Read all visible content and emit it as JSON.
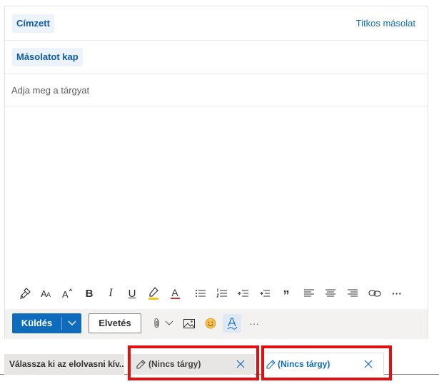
{
  "compose": {
    "to_label": "Címzett",
    "bcc_label": "Titkos másolat",
    "cc_label": "Másolatot kap",
    "subject_placeholder": "Adja meg a tárgyat"
  },
  "format_toolbar": {
    "icons": [
      "format-painter-icon",
      "font-size-icon",
      "grow-font-icon",
      "bold-icon",
      "italic-icon",
      "underline-icon",
      "highlight-icon",
      "font-color-icon",
      "bullets-icon",
      "numbering-icon",
      "decrease-indent-icon",
      "increase-indent-icon",
      "quote-icon",
      "align-left-icon",
      "align-center-icon",
      "align-right-icon",
      "link-icon",
      "more-icon"
    ],
    "bold": "B",
    "italic": "I",
    "underline": "U",
    "font_color": "A",
    "quote": "”",
    "more": "···"
  },
  "actions": {
    "send_label": "Küldés",
    "discard_label": "Elvetés",
    "more": "···"
  },
  "tabs": {
    "reading_label": "Válassza ki az elolvasni kív...",
    "draft1_label": "(Nincs tárgy)",
    "draft2_label": "(Nincs tárgy)"
  },
  "colors": {
    "accent": "#0f6cbd",
    "highlight_box": "#e01010",
    "highlighter_yellow": "#f2c811",
    "font_color_red": "#d13438",
    "emoji_yellow": "#f7c04a"
  }
}
